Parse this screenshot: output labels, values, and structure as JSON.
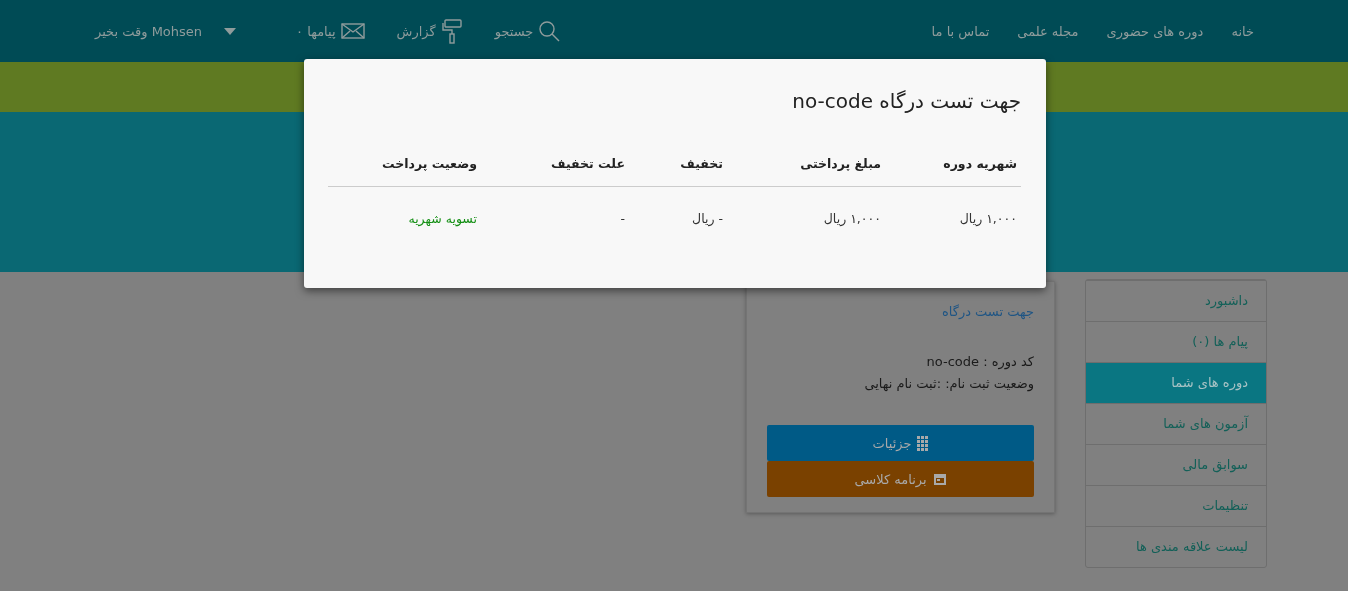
{
  "nav": {
    "links": [
      "خانه",
      "دوره های حضوری",
      "مجله علمی",
      "تماس با ما"
    ],
    "search": "جستجو",
    "report": "گزارش",
    "messages": "پیامها ۰",
    "greeting": "Mohsen وقت بخیر"
  },
  "sidebar": {
    "items": [
      {
        "label": "داشبورد",
        "selected": false
      },
      {
        "label": "پیام ها (۰)",
        "selected": false
      },
      {
        "label": "دوره های شما",
        "selected": true
      },
      {
        "label": "آزمون های شما",
        "selected": false
      },
      {
        "label": "سوابق مالی",
        "selected": false
      },
      {
        "label": "تنظیمات",
        "selected": false
      },
      {
        "label": "لیست علاقه مندی ها",
        "selected": false
      }
    ]
  },
  "course_card": {
    "title": "جهت تست درگاه",
    "code_line": "کد دوره : no-code",
    "status_line": "وضعیت ثبت نام: :ثبت نام نهایی",
    "buttons": [
      {
        "label": "جزئیات",
        "kind": "details"
      },
      {
        "label": "برنامه کلاسی",
        "kind": "schedule"
      }
    ]
  },
  "modal": {
    "title": "جهت تست درگاه no-code",
    "table": {
      "columns": [
        "شهریه دوره",
        "مبلغ پرداختی",
        "تخفیف",
        "علت تخفیف",
        "وضعیت پرداخت"
      ],
      "rows": [
        [
          "۱,۰۰۰ ریال",
          "۱,۰۰۰ ریال",
          "- ریال",
          "-",
          "تسویه شهریه"
        ]
      ]
    }
  }
}
